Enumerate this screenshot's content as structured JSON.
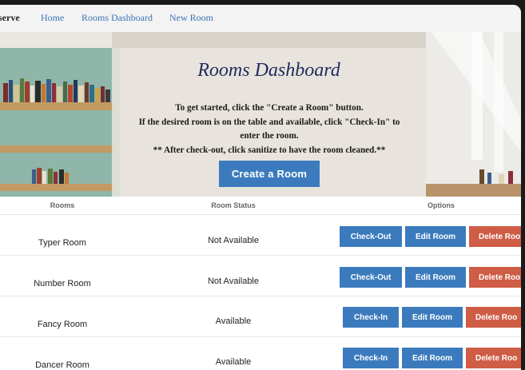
{
  "navbar": {
    "brand": "serve",
    "links": [
      "Home",
      "Rooms Dashboard",
      "New Room"
    ]
  },
  "hero": {
    "title": "Rooms Dashboard",
    "lines": [
      "To get started, click the \"Create a Room\" button.",
      "If the desired room is on the table and available, click \"Check-In\" to",
      "enter the room.",
      "** After check-out, click sanitize to have the room cleaned.**"
    ],
    "create_button": "Create a Room"
  },
  "table": {
    "headers": [
      "Rooms",
      "Room Status",
      "Options"
    ],
    "rows": [
      {
        "name": "Typer Room",
        "status": "Not Available",
        "action": "Check-Out",
        "edit": "Edit Room",
        "delete": "Delete Roo"
      },
      {
        "name": "Number Room",
        "status": "Not Available",
        "action": "Check-Out",
        "edit": "Edit Room",
        "delete": "Delete Roo"
      },
      {
        "name": "Fancy Room",
        "status": "Available",
        "action": "Check-In",
        "edit": "Edit Room",
        "delete": "Delete Roo"
      },
      {
        "name": "Dancer Room",
        "status": "Available",
        "action": "Check-In",
        "edit": "Edit Room",
        "delete": "Delete Roo"
      }
    ]
  },
  "colors": {
    "primary": "#3b7bbd",
    "danger": "#cf5c45",
    "nav_link": "#3a76b7",
    "title": "#1f2a5c"
  }
}
